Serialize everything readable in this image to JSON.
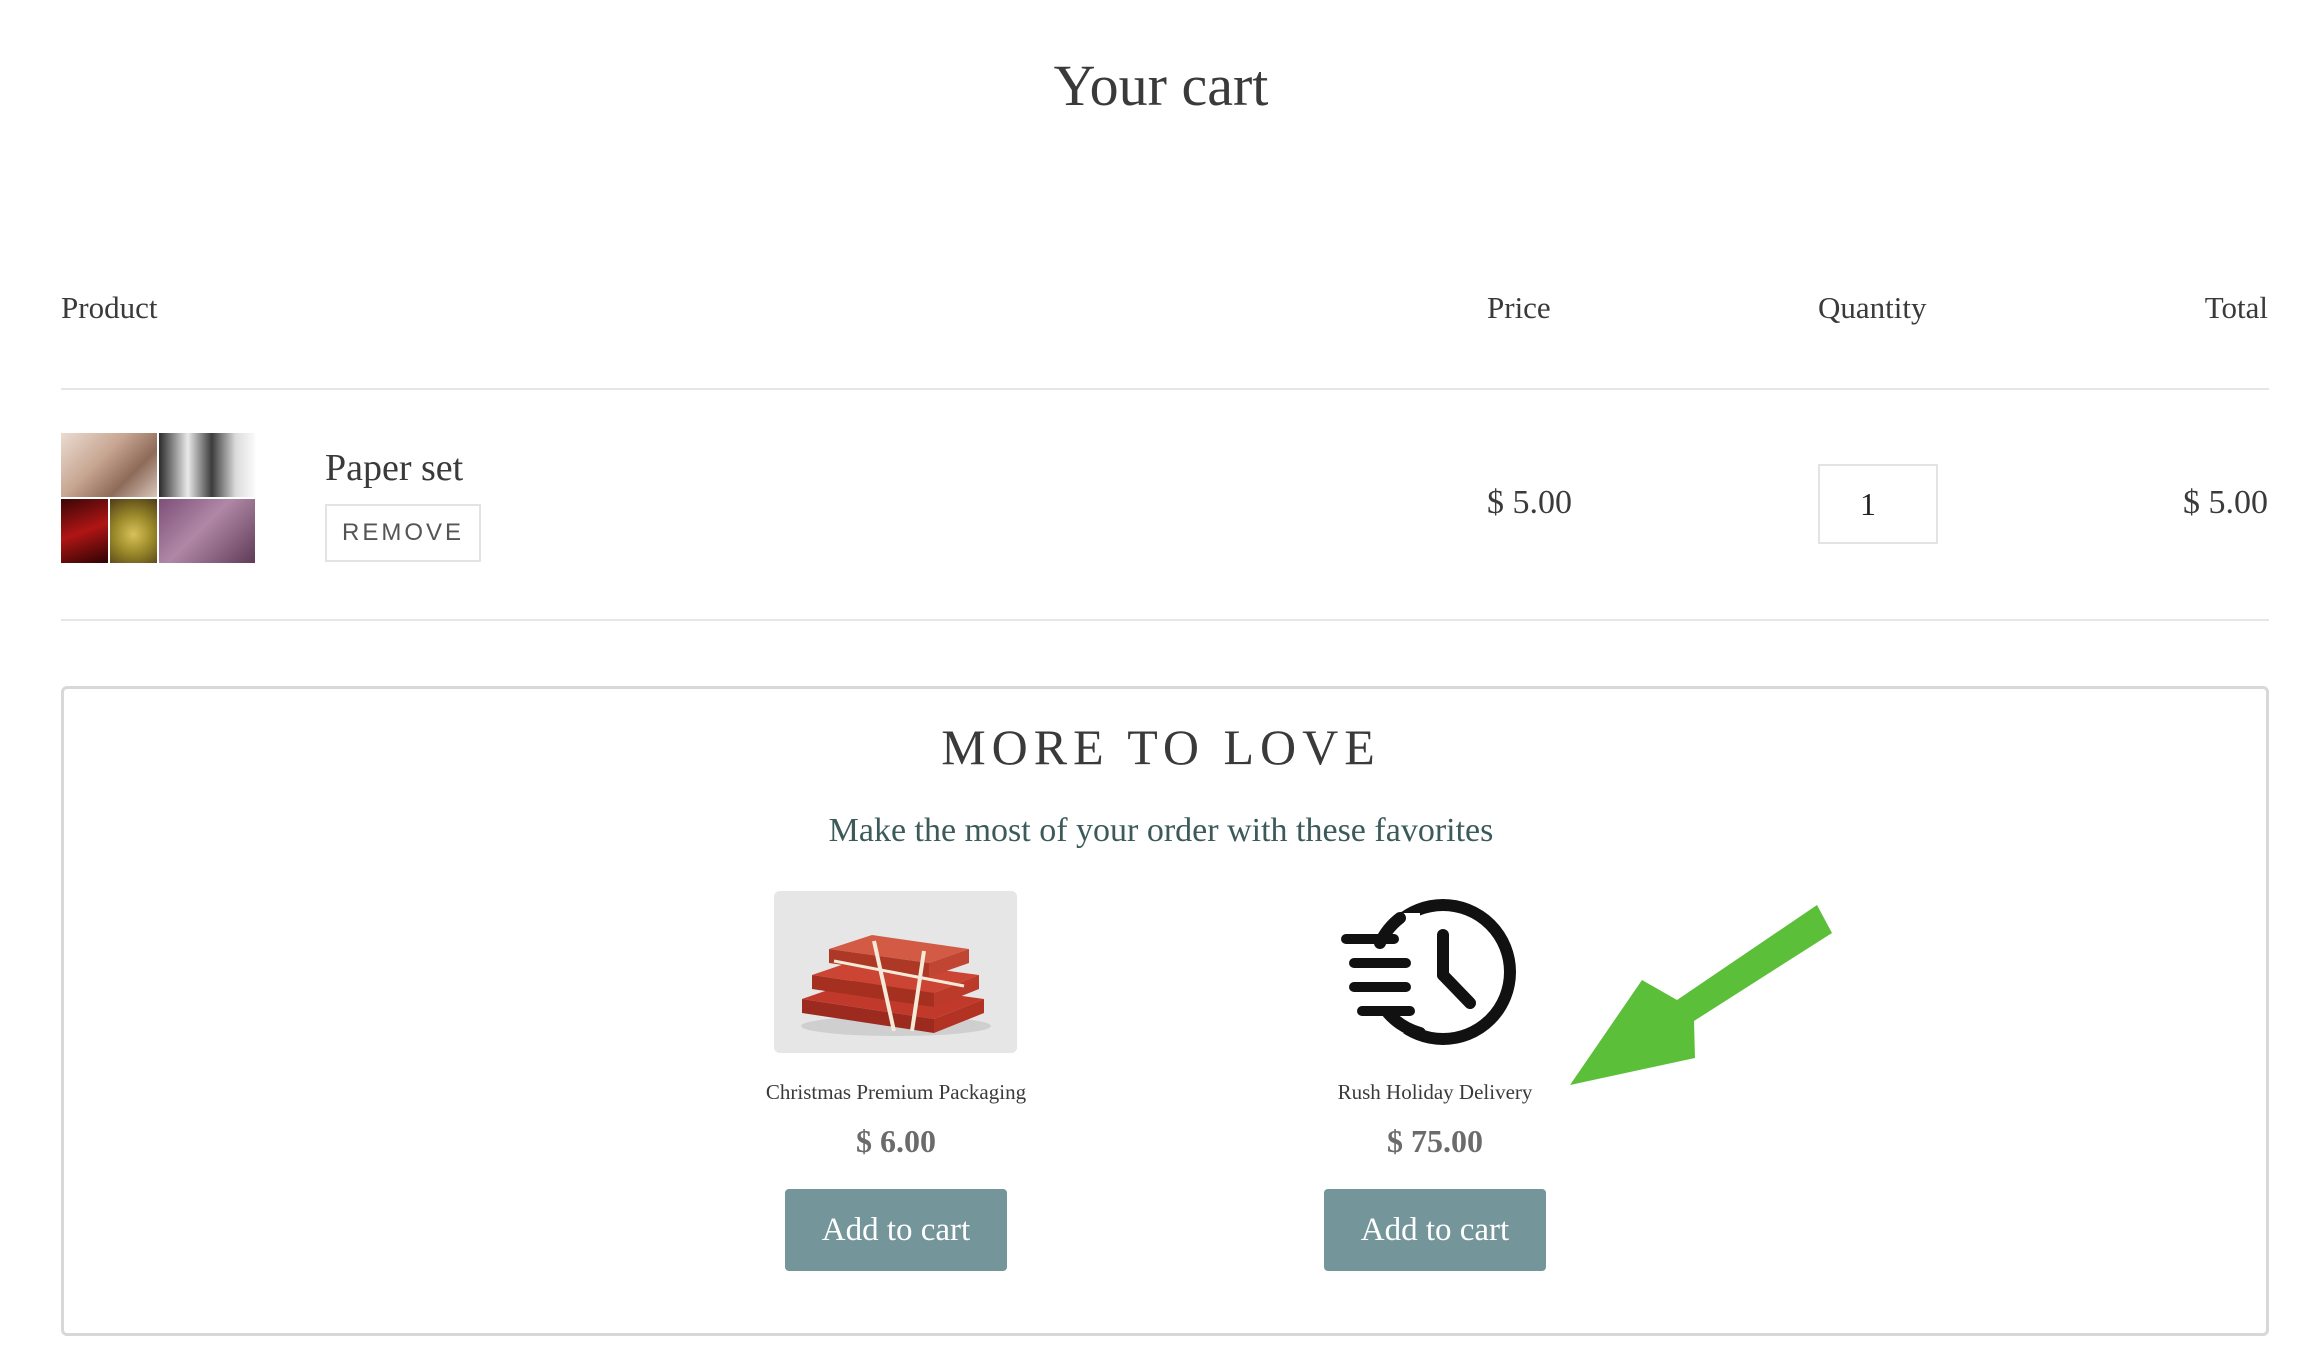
{
  "page": {
    "title": "Your cart"
  },
  "table": {
    "headers": {
      "product": "Product",
      "price": "Price",
      "quantity": "Quantity",
      "total": "Total"
    }
  },
  "items": [
    {
      "name": "Paper set",
      "remove_label": "REMOVE",
      "price": "$ 5.00",
      "quantity": "1",
      "total": "$ 5.00"
    }
  ],
  "upsell": {
    "title": "MORE TO LOVE",
    "subtitle": "Make the most of your order with these favorites",
    "products": [
      {
        "name": "Christmas Premium Packaging",
        "price": "$ 6.00",
        "button": "Add to cart",
        "image": "wrapped-gift-boxes"
      },
      {
        "name": "Rush Holiday Delivery",
        "price": "$ 75.00",
        "button": "Add to cart",
        "icon": "fast-clock-icon"
      }
    ]
  },
  "annotation": {
    "arrow_color": "#5cbf3a",
    "icon": "green-arrow-icon"
  },
  "colors": {
    "button_bg": "#74969a",
    "subtitle": "#3b5a59",
    "divider": "#e6e6e6"
  }
}
